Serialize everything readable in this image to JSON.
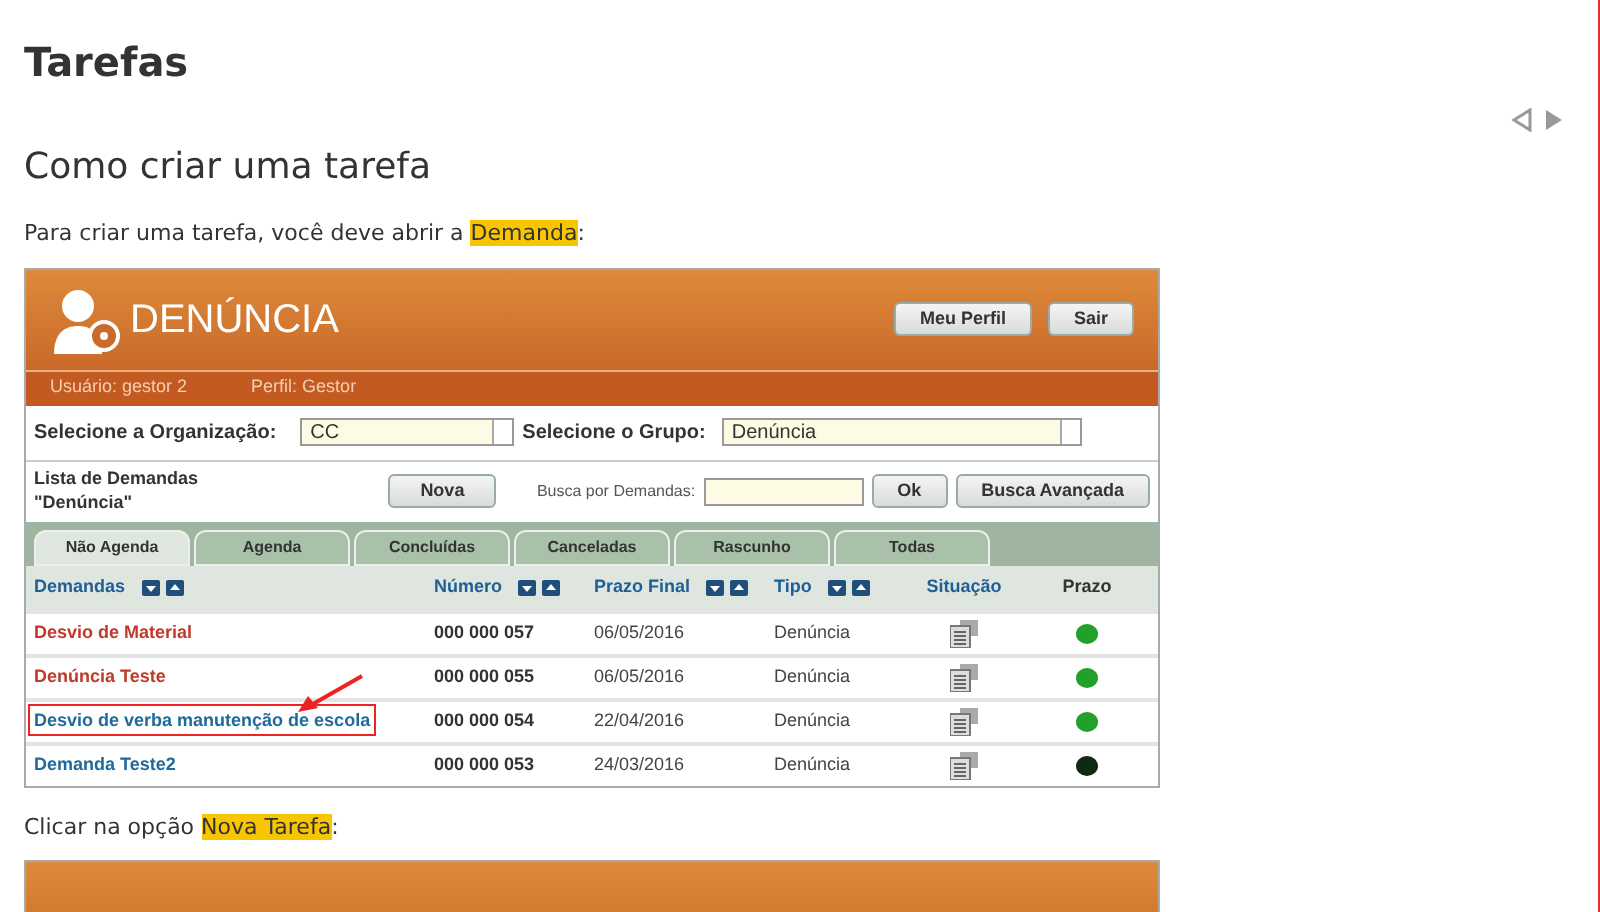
{
  "page": {
    "title": "Tarefas",
    "section_title": "Como criar uma tarefa",
    "intro": {
      "before": "Para criar uma tarefa, você deve abrir a",
      "highlight": "Demanda",
      "after": ":"
    },
    "outro": {
      "before": "Clicar na opção",
      "highlight": "Nova Tarefa",
      "after": ":"
    }
  },
  "app": {
    "title": "DENÚNCIA",
    "buttons": [
      "Meu Perfil",
      "Sair"
    ],
    "user": "Usuário: gestor 2",
    "profile": "Perfil: Gestor",
    "org_label": "Selecione a Organização:",
    "org_value": "CC",
    "group_label": "Selecione o Grupo:",
    "group_value": "Denúncia",
    "list_title": "Lista de Demandas \"Denúncia\"",
    "new_button": "Nova",
    "search_label": "Busca por Demandas:",
    "ok_button": "Ok",
    "advanced_button": "Busca Avançada",
    "tabs": [
      {
        "label": "Não Agenda",
        "selected": true
      },
      {
        "label": "Agenda",
        "selected": false
      },
      {
        "label": "Concluídas",
        "selected": false
      },
      {
        "label": "Canceladas",
        "selected": false
      },
      {
        "label": "Rascunho",
        "selected": false
      },
      {
        "label": "Todas",
        "selected": false
      }
    ],
    "columns": [
      {
        "label": "Demandas",
        "sortable": true
      },
      {
        "label": "Número",
        "sortable": true
      },
      {
        "label": "Prazo Final",
        "sortable": true
      },
      {
        "label": "Tipo",
        "sortable": true
      },
      {
        "label": "Situação",
        "sortable": false
      },
      {
        "label": "Prazo",
        "sortable": false
      }
    ],
    "rows": [
      {
        "name": "Desvio de Material",
        "color": "#c0392b",
        "number": "000 000 057",
        "deadline": "06/05/2016",
        "type": "Denúncia",
        "prazo": {
          "color": "#22a02a"
        },
        "highlighted": false
      },
      {
        "name": "Denúncia Teste",
        "color": "#c0392b",
        "number": "000 000 055",
        "deadline": "06/05/2016",
        "type": "Denúncia",
        "prazo": {
          "color": "#22a02a"
        },
        "highlighted": false
      },
      {
        "name": "Desvio de verba manutenção de escola",
        "color": "#1f6a9a",
        "number": "000 000 054",
        "deadline": "22/04/2016",
        "type": "Denúncia",
        "prazo": {
          "color": "#22a02a"
        },
        "highlighted": true
      },
      {
        "name": "Demanda Teste2",
        "color": "#1f6a9a",
        "number": "000 000 053",
        "deadline": "24/03/2016",
        "type": "Denúncia",
        "prazo": {
          "color": "#0f2a12"
        },
        "highlighted": false
      }
    ]
  }
}
